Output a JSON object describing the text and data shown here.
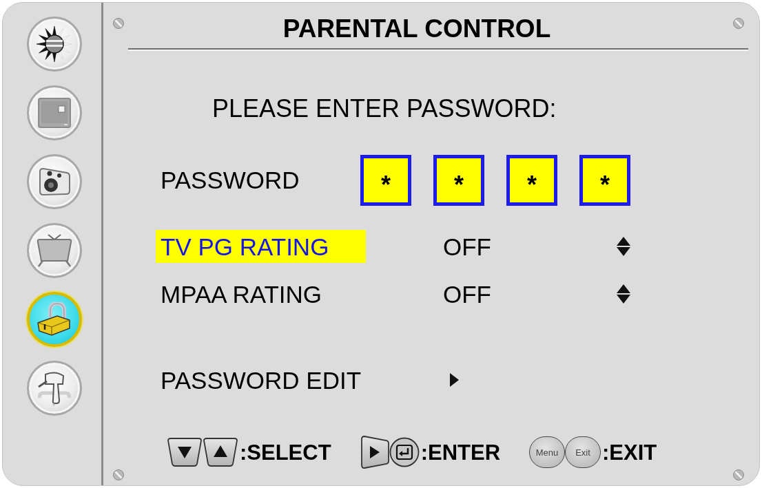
{
  "sidebar": {
    "items": [
      {
        "selected": false
      },
      {
        "selected": false
      },
      {
        "selected": false
      },
      {
        "selected": false
      },
      {
        "selected": true
      },
      {
        "selected": false
      }
    ]
  },
  "title": "PARENTAL CONTROL",
  "prompt": "PLEASE ENTER PASSWORD:",
  "password": {
    "label": "PASSWORD",
    "digits": [
      "*",
      "*",
      "*",
      "*"
    ]
  },
  "menu": [
    {
      "kind": "option",
      "label": "TV PG RATING",
      "value": "OFF",
      "selected": true
    },
    {
      "kind": "option",
      "label": "MPAA RATING",
      "value": "OFF",
      "selected": false
    },
    {
      "kind": "submenu",
      "label": "PASSWORD EDIT",
      "selected": false
    }
  ],
  "footer": {
    "hints": [
      {
        "keys": [
          {
            "kind": "down"
          },
          {
            "kind": "up"
          }
        ],
        "label": ":SELECT"
      },
      {
        "keys": [
          {
            "kind": "right"
          },
          {
            "kind": "enter"
          }
        ],
        "label": ":ENTER"
      },
      {
        "keys": [
          {
            "kind": "text",
            "text": "Menu"
          },
          {
            "kind": "text",
            "text": "Exit"
          }
        ],
        "label": ":EXIT"
      }
    ]
  }
}
